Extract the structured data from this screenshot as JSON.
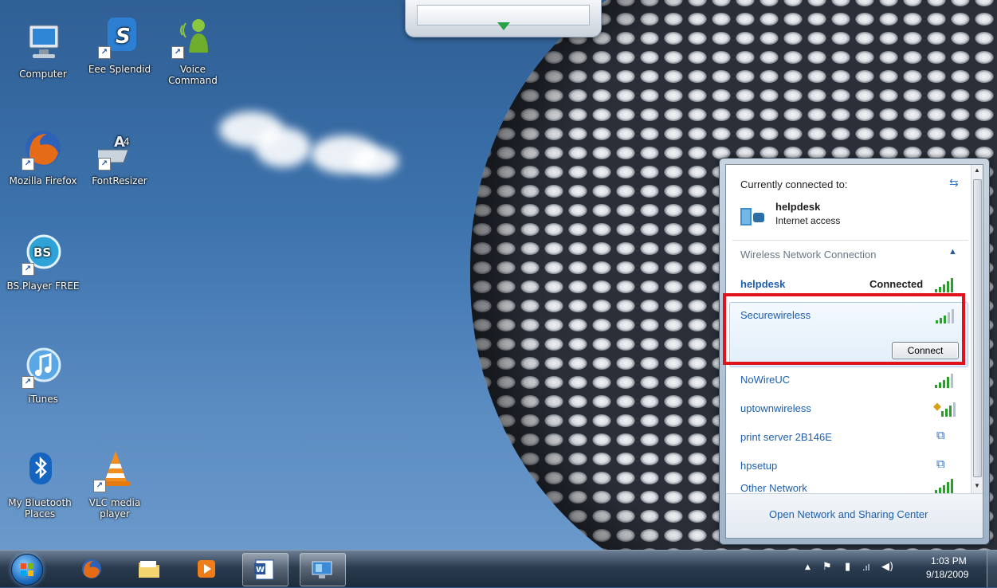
{
  "desktop_icons": [
    {
      "label": "Computer",
      "icon": "computer-icon"
    },
    {
      "label": "Eee Splendid",
      "icon": "eee-splendid-icon"
    },
    {
      "label": "Voice Command",
      "icon": "voice-command-icon"
    },
    {
      "label": "Mozilla Firefox",
      "icon": "firefox-icon"
    },
    {
      "label": "FontResizer",
      "icon": "fontresizer-icon"
    },
    {
      "label": "BS.Player FREE",
      "icon": "bsplayer-icon",
      "glyph": "BS"
    },
    {
      "label": "iTunes",
      "icon": "itunes-icon"
    },
    {
      "label": "My Bluetooth Places",
      "icon": "bluetooth-icon"
    },
    {
      "label": "VLC media player",
      "icon": "vlc-icon"
    }
  ],
  "network_flyout": {
    "header": "Currently connected to:",
    "connected_network": {
      "name": "helpdesk",
      "status": "Internet access"
    },
    "section_title": "Wireless Network Connection",
    "networks": [
      {
        "name": "helpdesk",
        "status": "Connected",
        "secured": false
      },
      {
        "name": "Securewireless",
        "status": "",
        "secured": false
      },
      {
        "name": "NoWireUC",
        "status": "",
        "secured": false
      },
      {
        "name": "uptownwireless",
        "status": "",
        "secured": true
      },
      {
        "name": "print server 2B146E",
        "status": "",
        "secured": true
      },
      {
        "name": "hpsetup",
        "status": "",
        "secured": true
      },
      {
        "name": "Other Network",
        "status": "",
        "secured": false
      }
    ],
    "connect_button": "Connect",
    "footer_link": "Open Network and Sharing Center",
    "colors": {
      "link": "#1d5fae",
      "highlight": "#e0121c",
      "signal": "#29a02c"
    }
  },
  "taskbar": {
    "items": [
      {
        "name": "start-button",
        "icon": "windows-orb-icon"
      },
      {
        "name": "firefox",
        "icon": "firefox-icon"
      },
      {
        "name": "windows-explorer",
        "icon": "folder-icon"
      },
      {
        "name": "media-player",
        "icon": "media-player-icon"
      },
      {
        "name": "word",
        "icon": "word-icon"
      },
      {
        "name": "remote-desktop",
        "icon": "network-computer-icon"
      }
    ],
    "tray": {
      "time": "1:03 PM",
      "date": "9/18/2009"
    }
  }
}
